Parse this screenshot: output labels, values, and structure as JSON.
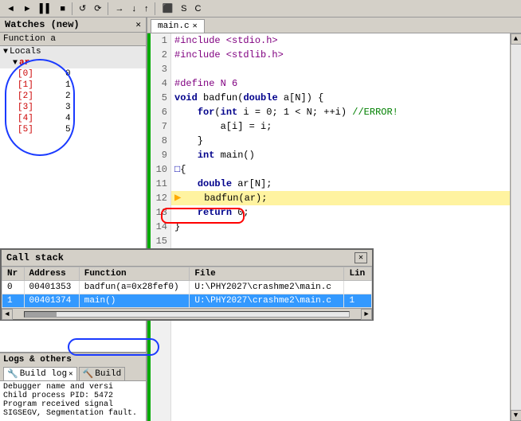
{
  "toolbar": {
    "buttons": [
      "◄",
      "►",
      "▐▐",
      "■",
      "↺",
      "⟳"
    ]
  },
  "watches": {
    "title": "Watches (new)",
    "locals_label": "Locals",
    "ar_label": "ar",
    "items": [
      {
        "index": "[0]",
        "value": "0"
      },
      {
        "index": "[1]",
        "value": "1"
      },
      {
        "index": "[2]",
        "value": "2"
      },
      {
        "index": "[3]",
        "value": "3"
      },
      {
        "index": "[4]",
        "value": "4"
      },
      {
        "index": "[5]",
        "value": "5"
      }
    ],
    "function_label": "Function a"
  },
  "editor": {
    "tab": "main.c",
    "lines": [
      {
        "num": "1",
        "code": "#include <stdio.h>",
        "type": "pp"
      },
      {
        "num": "2",
        "code": "#include <stdlib.h>",
        "type": "pp"
      },
      {
        "num": "3",
        "code": ""
      },
      {
        "num": "4",
        "code": "#define N 6",
        "type": "pp"
      },
      {
        "num": "5",
        "code": "void badfun(double a[N]) {",
        "type": "fn"
      },
      {
        "num": "6",
        "code": "    for(int i = 0; i < N; ++i) //ERROR!",
        "type": "code"
      },
      {
        "num": "7",
        "code": "        a[i] = i;",
        "type": "code"
      },
      {
        "num": "8",
        "code": "    }",
        "type": "code"
      },
      {
        "num": "9",
        "code": "    int main()",
        "type": "fn"
      },
      {
        "num": "10",
        "code": "{",
        "type": "code"
      },
      {
        "num": "11",
        "code": "    double ar[N];",
        "type": "code"
      },
      {
        "num": "12",
        "code": "    badfun(ar);",
        "type": "active"
      },
      {
        "num": "13",
        "code": "    return 0;",
        "type": "code"
      },
      {
        "num": "14",
        "code": "}",
        "type": "code"
      },
      {
        "num": "15",
        "code": ""
      }
    ]
  },
  "callstack": {
    "title": "Call stack",
    "columns": [
      "Nr",
      "Address",
      "Function",
      "File",
      "Lin"
    ],
    "rows": [
      {
        "nr": "0",
        "address": "00401353",
        "function": "badfun(a=0x28fef0)",
        "file": "U:\\PHY2027\\crashme2\\main.c",
        "line": ""
      },
      {
        "nr": "1",
        "address": "00401374",
        "function": "main()",
        "file": "U:\\PHY2027\\crashme2\\main.c",
        "line": "1"
      }
    ]
  },
  "bottom": {
    "logs_others_label": "Logs & others",
    "tabs": [
      {
        "label": "Build log",
        "active": true
      },
      {
        "label": "Build"
      }
    ],
    "log_lines": [
      "Debugger name and versi",
      "Child process PID: 5472",
      "Program received signal SIGSEGV, Segmentation fault."
    ]
  }
}
